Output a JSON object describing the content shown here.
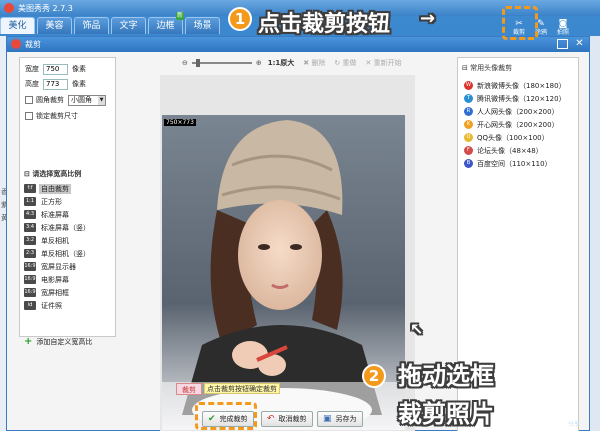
{
  "app": {
    "title": "美图秀秀 2.7.3",
    "tabs": [
      {
        "label": "美化",
        "active": true
      },
      {
        "label": "美容",
        "active": false
      },
      {
        "label": "饰品",
        "active": false
      },
      {
        "label": "文字",
        "active": false
      },
      {
        "label": "边框",
        "active": false,
        "badge": "新"
      },
      {
        "label": "场景",
        "active": false
      }
    ],
    "right_tools": [
      {
        "label": "裁剪",
        "icon": "scissors-icon"
      },
      {
        "label": "涂鸦",
        "icon": "pen-icon"
      },
      {
        "label": "拍照",
        "icon": "camera-icon"
      }
    ],
    "left_strip": [
      "香",
      "紫",
      "黄"
    ],
    "bottom_right": "分享"
  },
  "dialog": {
    "title": "裁剪",
    "width_label": "宽度",
    "width_value": "750",
    "height_label": "高度",
    "height_value": "773",
    "unit": "像素",
    "rounded_label": "圆角裁剪",
    "rounded_option": "小圆角",
    "lock_label": "锁定裁剪尺寸",
    "ratio_header": "请选择宽高比例",
    "ratios": [
      {
        "icon": "f:f",
        "label": "自由裁剪",
        "active": true
      },
      {
        "icon": "1:1",
        "label": "正方形",
        "active": false
      },
      {
        "icon": "4:3",
        "label": "标准屏幕",
        "active": false
      },
      {
        "icon": "3:4",
        "label": "标准屏幕（竖）",
        "active": false
      },
      {
        "icon": "3:2",
        "label": "单反相机",
        "active": false
      },
      {
        "icon": "2:3",
        "label": "单反相机（竖）",
        "active": false
      },
      {
        "icon": "16:9",
        "label": "宽屏显示器",
        "active": false
      },
      {
        "icon": "16:9",
        "label": "电影屏幕",
        "active": false
      },
      {
        "icon": "16:9",
        "label": "宽屏相框",
        "active": false
      },
      {
        "icon": "id",
        "label": "证件照",
        "active": false
      }
    ],
    "add_ratio": "添加自定义宽高比",
    "toolbar": {
      "ratio": "1:1原大",
      "delete": "删除",
      "redo": "重做",
      "reset": "重新开始"
    },
    "crop_size": "750×773",
    "crop_tag": "裁剪",
    "crop_hint": "点击裁剪按钮确定裁剪",
    "right_header": "常用头像裁剪",
    "presets": [
      {
        "label": "新浪微博头像（180×180）",
        "color": "#e0322b"
      },
      {
        "label": "腾讯微博头像（120×120）",
        "color": "#2b8fd6"
      },
      {
        "label": "人人网头像（200×200）",
        "color": "#2f6fcf"
      },
      {
        "label": "开心网头像（200×200）",
        "color": "#f0a020"
      },
      {
        "label": "QQ头像（100×100）",
        "color": "#e9b82a"
      },
      {
        "label": "论坛头像（48×48）",
        "color": "#d24b4b"
      },
      {
        "label": "百度空间（110×110）",
        "color": "#3a56c8"
      }
    ],
    "buttons": {
      "confirm": "完成裁剪",
      "cancel": "取消裁剪",
      "save_as": "另存为"
    }
  },
  "annotations": {
    "step1_number": "1",
    "step1_text": "点击裁剪按钮",
    "step2_number": "2",
    "step2_line1": "拖动选框",
    "step2_line2": "裁剪照片"
  },
  "colors": {
    "accent": "#f39a1c",
    "titlebar": "#3b82c8"
  }
}
